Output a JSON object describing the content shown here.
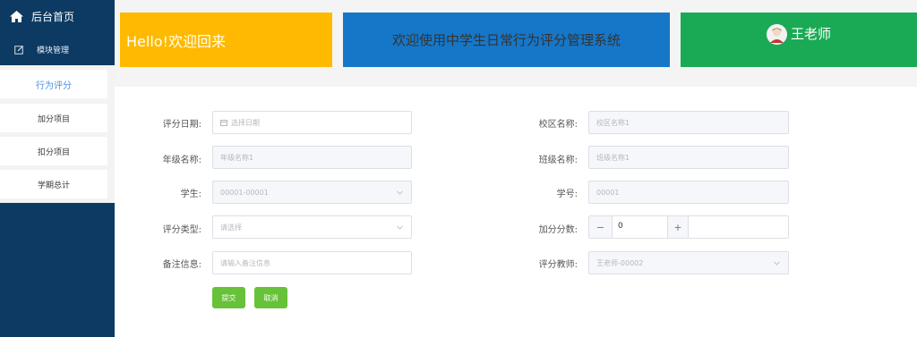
{
  "sidebar": {
    "home_label": "后台首页",
    "module_label": "模块管理",
    "items": [
      {
        "label": "行为评分",
        "active": true
      },
      {
        "label": "加分项目",
        "active": false
      },
      {
        "label": "扣分项目",
        "active": false
      },
      {
        "label": "学期总计",
        "active": false
      }
    ]
  },
  "header": {
    "welcome_back": "Hello!欢迎回来",
    "system_title": "欢迎使用中学生日常行为评分管理系统",
    "user_name": "王老师"
  },
  "form": {
    "score_date": {
      "label": "评分日期:",
      "placeholder": "选择日期"
    },
    "campus": {
      "label": "校区名称:",
      "value": "校区名称1"
    },
    "grade": {
      "label": "年级名称:",
      "value": "年级名称1"
    },
    "class": {
      "label": "班级名称:",
      "value": "班级名称1"
    },
    "student": {
      "label": "学生:",
      "value": "00001-00001"
    },
    "student_no": {
      "label": "学号:",
      "value": "00001"
    },
    "score_type": {
      "label": "评分类型:",
      "placeholder": "请选择"
    },
    "bonus_score": {
      "label": "加分分数:",
      "value": "0",
      "minus": "−",
      "plus": "+"
    },
    "remark": {
      "label": "备注信息:",
      "placeholder": "请输入备注信息"
    },
    "teacher": {
      "label": "评分教师:",
      "value": "王老师-00002"
    },
    "submit_label": "提交",
    "cancel_label": "取消"
  },
  "colors": {
    "sidebar_bg": "#0d3a63",
    "card_yellow": "#ffb900",
    "card_blue": "#1677c9",
    "card_green": "#1aaa55",
    "button_green": "#67c23a",
    "active_text": "#4a90e2"
  },
  "icons": {
    "home": "home-icon",
    "module": "edit-icon",
    "calendar": "calendar-icon",
    "chevron": "chevron-down-icon",
    "avatar": "avatar"
  }
}
